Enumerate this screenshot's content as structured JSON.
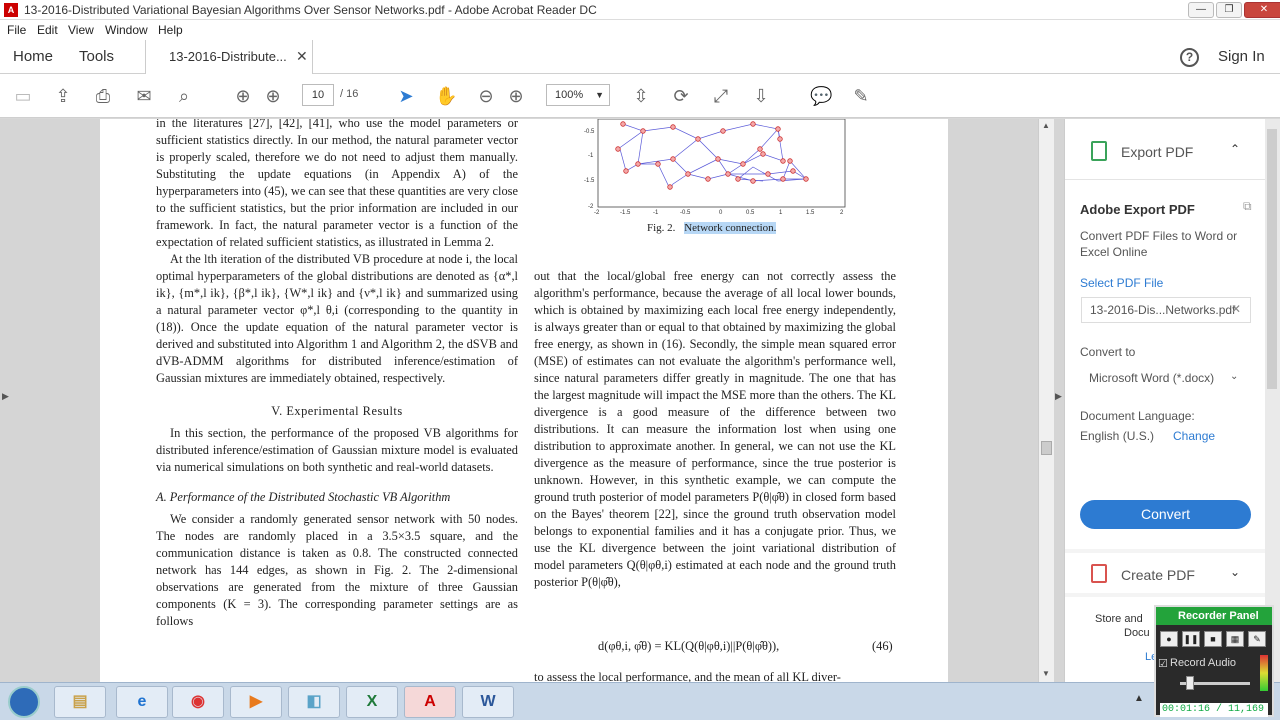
{
  "window": {
    "title": "13-2016-Distributed Variational Bayesian Algorithms Over Sensor Networks.pdf - Adobe Acrobat Reader DC"
  },
  "menu": [
    "File",
    "Edit",
    "View",
    "Window",
    "Help"
  ],
  "tabs": {
    "home": "Home",
    "tools": "Tools",
    "doc": "13-2016-Distribute...",
    "signin": "Sign In"
  },
  "toolbar": {
    "page_current": "10",
    "page_total": "/ 16",
    "zoom": "100%"
  },
  "figure": {
    "caption_prefix": "Fig. 2.",
    "caption_highlight": "Network connection.",
    "y_ticks": [
      "-0.5",
      "-1",
      "-1.5",
      "-2"
    ],
    "x_ticks": [
      "-2",
      "-1.5",
      "-1",
      "-0.5",
      "0",
      "0.5",
      "1",
      "1.5",
      "2"
    ]
  },
  "document": {
    "left_col": [
      "in the literatures [27], [42], [41], who use the model parameters or sufficient statistics directly. In our method, the natural parameter vector is properly scaled, therefore we do not need to adjust them manually. Substituting the update equations (in Appendix A) of the hyperparameters into (45), we can see that these quantities are very close to the sufficient statistics, but the prior information are included in our framework. In fact, the natural parameter vector is a function of the expectation of related sufficient statistics, as illustrated in Lemma 2.",
      "At the lth iteration of the distributed VB procedure at node i, the local optimal hyperparameters of the global distributions are denoted as {α*,l ik}, {m*,l ik}, {β*,l ik}, {W*,l ik} and {ν*,l ik} and summarized using a natural parameter vector φ*,l θ,i (corresponding to the quantity in (18)). Once the update equation of the natural parameter vector is derived and substituted into Algorithm 1 and Algorithm 2, the dSVB and dVB-ADMM algorithms for distributed inference/estimation of Gaussian mixtures are immediately obtained, respectively."
    ],
    "section_title": "V.  Experimental Results",
    "left_col2": "In this section, the performance of the proposed VB algorithms for distributed inference/estimation of Gaussian mixture model is evaluated via numerical simulations on both synthetic and real-world datasets.",
    "subsection_title": "A.  Performance of the Distributed Stochastic VB Algorithm",
    "left_col3": "We consider a randomly generated sensor network with 50 nodes. The nodes are randomly placed in a 3.5×3.5 square, and the communication distance is taken as 0.8. The constructed connected network has 144 edges, as shown in Fig. 2. The 2-dimensional observations are generated from the mixture of three Gaussian components (K = 3). The corresponding parameter settings are as follows",
    "right_col": "out that the local/global free energy can not correctly assess the algorithm's performance, because the average of all local lower bounds, which is obtained by maximizing each local free energy independently, is always greater than or equal to that obtained by maximizing the global free energy, as shown in (16). Secondly, the simple mean squared error (MSE) of estimates can not evaluate the algorithm's performance well, since natural parameters differ greatly in magnitude. The one that has the largest magnitude will impact the MSE more than the others. The KL divergence is a good measure of the difference between two distributions. It can measure the information lost when using one distribution to approximate another. In general, we can not use the KL divergence as the measure of performance, since the true posterior is unknown. However, in this synthetic example, we can compute the ground truth posterior of model parameters P(θ|φ̂θ) in closed form based on the Bayes' theorem [22], since the ground truth observation model belongs to exponential families and it has a conjugate prior. Thus, we use the KL divergence between the joint variational distribution of model parameters Q(θ|φθ,i) estimated at each node and the ground truth posterior P(θ|φ̂θ),",
    "equation": "d(φθ,i, φ̂θ) = KL(Q(θ|φθ,i)||P(θ|φ̂θ)),",
    "equation_num": "(46)",
    "right_col_end": "to assess the local performance, and the mean of all KL diver-"
  },
  "panel": {
    "export_title": "Export PDF",
    "adobe_export_title": "Adobe Export PDF",
    "adobe_export_desc": "Convert PDF Files to Word or Excel Online",
    "select_label": "Select PDF File",
    "selected_file": "13-2016-Dis...Networks.pdf",
    "convert_to_label": "Convert to",
    "convert_to_value": "Microsoft Word (*.docx)",
    "doc_lang_label": "Document Language:",
    "doc_lang_value": "English (U.S.)",
    "change_link": "Change",
    "convert_button": "Convert",
    "create_title": "Create PDF",
    "store_text": "Store and",
    "store_text2": "Docu",
    "learn": "Le"
  },
  "recorder": {
    "title": "Recorder Panel",
    "audio_label": "Record Audio",
    "time": "00:01:16 / 11,169"
  },
  "colors": {
    "accent": "#2d7bd2",
    "recorder_green": "#23a33b",
    "highlight": "#b7d7f5"
  }
}
